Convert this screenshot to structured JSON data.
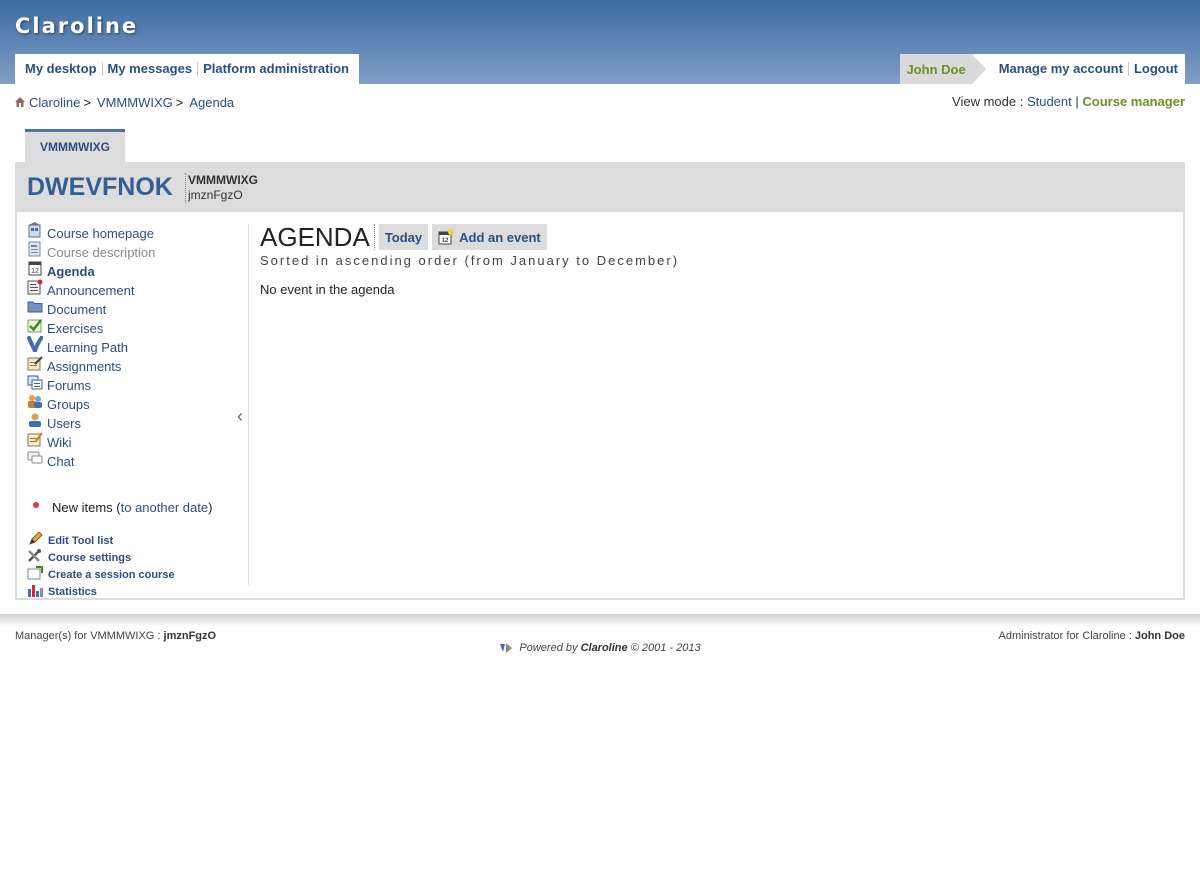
{
  "platform": {
    "name": "Claroline"
  },
  "user_menu": {
    "items": [
      "My desktop",
      "My messages",
      "Platform administration"
    ]
  },
  "account": {
    "username": "John Doe",
    "manage": "Manage my account",
    "logout": "Logout"
  },
  "breadcrumb": {
    "items": [
      "Claroline",
      "VMMMWIXG",
      "Agenda"
    ],
    "separator": ">"
  },
  "view_mode": {
    "label": "View mode :",
    "student": "Student",
    "separator": "|",
    "manager": "Course manager"
  },
  "course": {
    "tab": "VMMMWIXG",
    "code": "DWEVFNOK",
    "title": "VMMMWIXG",
    "titular": "jmznFgzO"
  },
  "tools": [
    {
      "label": "Course homepage",
      "icon": "course-homepage-icon",
      "state": "normal"
    },
    {
      "label": "Course description",
      "icon": "course-description-icon",
      "state": "disabled"
    },
    {
      "label": "Agenda",
      "icon": "agenda-icon",
      "state": "current"
    },
    {
      "label": "Announcement",
      "icon": "announcement-icon",
      "state": "normal"
    },
    {
      "label": "Document",
      "icon": "folder-icon",
      "state": "normal"
    },
    {
      "label": "Exercises",
      "icon": "check-icon",
      "state": "normal"
    },
    {
      "label": "Learning Path",
      "icon": "learning-path-icon",
      "state": "normal"
    },
    {
      "label": "Assignments",
      "icon": "assignment-icon",
      "state": "normal"
    },
    {
      "label": "Forums",
      "icon": "forum-icon",
      "state": "normal"
    },
    {
      "label": "Groups",
      "icon": "groups-icon",
      "state": "normal"
    },
    {
      "label": "Users",
      "icon": "user-icon",
      "state": "normal"
    },
    {
      "label": "Wiki",
      "icon": "wiki-icon",
      "state": "normal"
    },
    {
      "label": "Chat",
      "icon": "chat-icon",
      "state": "normal"
    }
  ],
  "new_items": {
    "label": "New items (",
    "link": "to another date",
    "close": ")"
  },
  "admin_links": [
    {
      "label": "Edit Tool list",
      "icon": "pencil-icon"
    },
    {
      "label": "Course settings",
      "icon": "settings-icon"
    },
    {
      "label": "Create a session course",
      "icon": "session-icon"
    },
    {
      "label": "Statistics",
      "icon": "statistics-icon"
    }
  ],
  "agenda": {
    "title": "AGENDA",
    "today_button": "Today",
    "add_button": "Add an event",
    "sort_info": "Sorted in ascending order (from January to December)",
    "empty": "No event in the agenda"
  },
  "footer": {
    "managers_label": "Manager(s) for VMMMWIXG :",
    "managers_value": "jmznFgzO",
    "admin_label": "Administrator for Claroline :",
    "admin_value": "John Doe",
    "powered_prefix": "Powered by",
    "powered_brand": "Claroline",
    "powered_suffix": "© 2001 - 2013"
  },
  "colors": {
    "banner": "#4a73a6",
    "link": "#2a4f84",
    "accent_green": "#6b9128",
    "header_gray": "#dcdcdc"
  }
}
